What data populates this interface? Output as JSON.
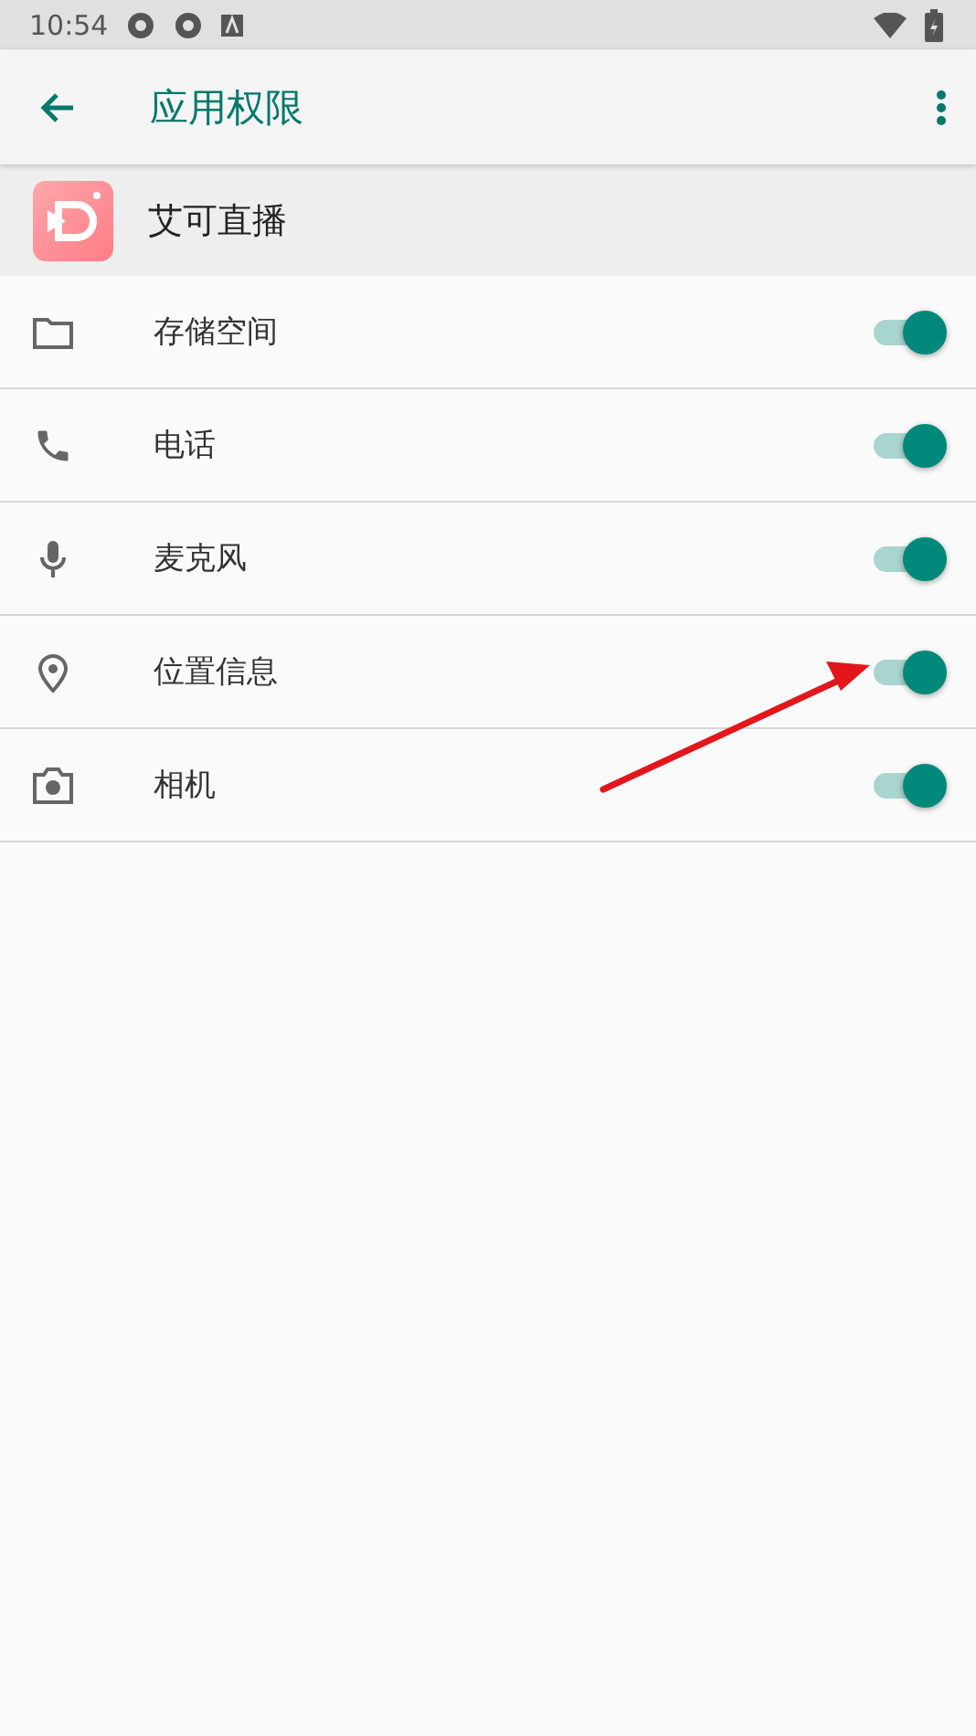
{
  "status_bar": {
    "time": "10:54"
  },
  "app_bar": {
    "title": "应用权限"
  },
  "app": {
    "name": "艾可直播"
  },
  "permissions": [
    {
      "kind": "folder",
      "label": "存储空间",
      "on": true
    },
    {
      "kind": "phone",
      "label": "电话",
      "on": true
    },
    {
      "kind": "mic",
      "label": "麦克风",
      "on": true
    },
    {
      "kind": "location",
      "label": "位置信息",
      "on": true
    },
    {
      "kind": "camera",
      "label": "相机",
      "on": true
    }
  ]
}
